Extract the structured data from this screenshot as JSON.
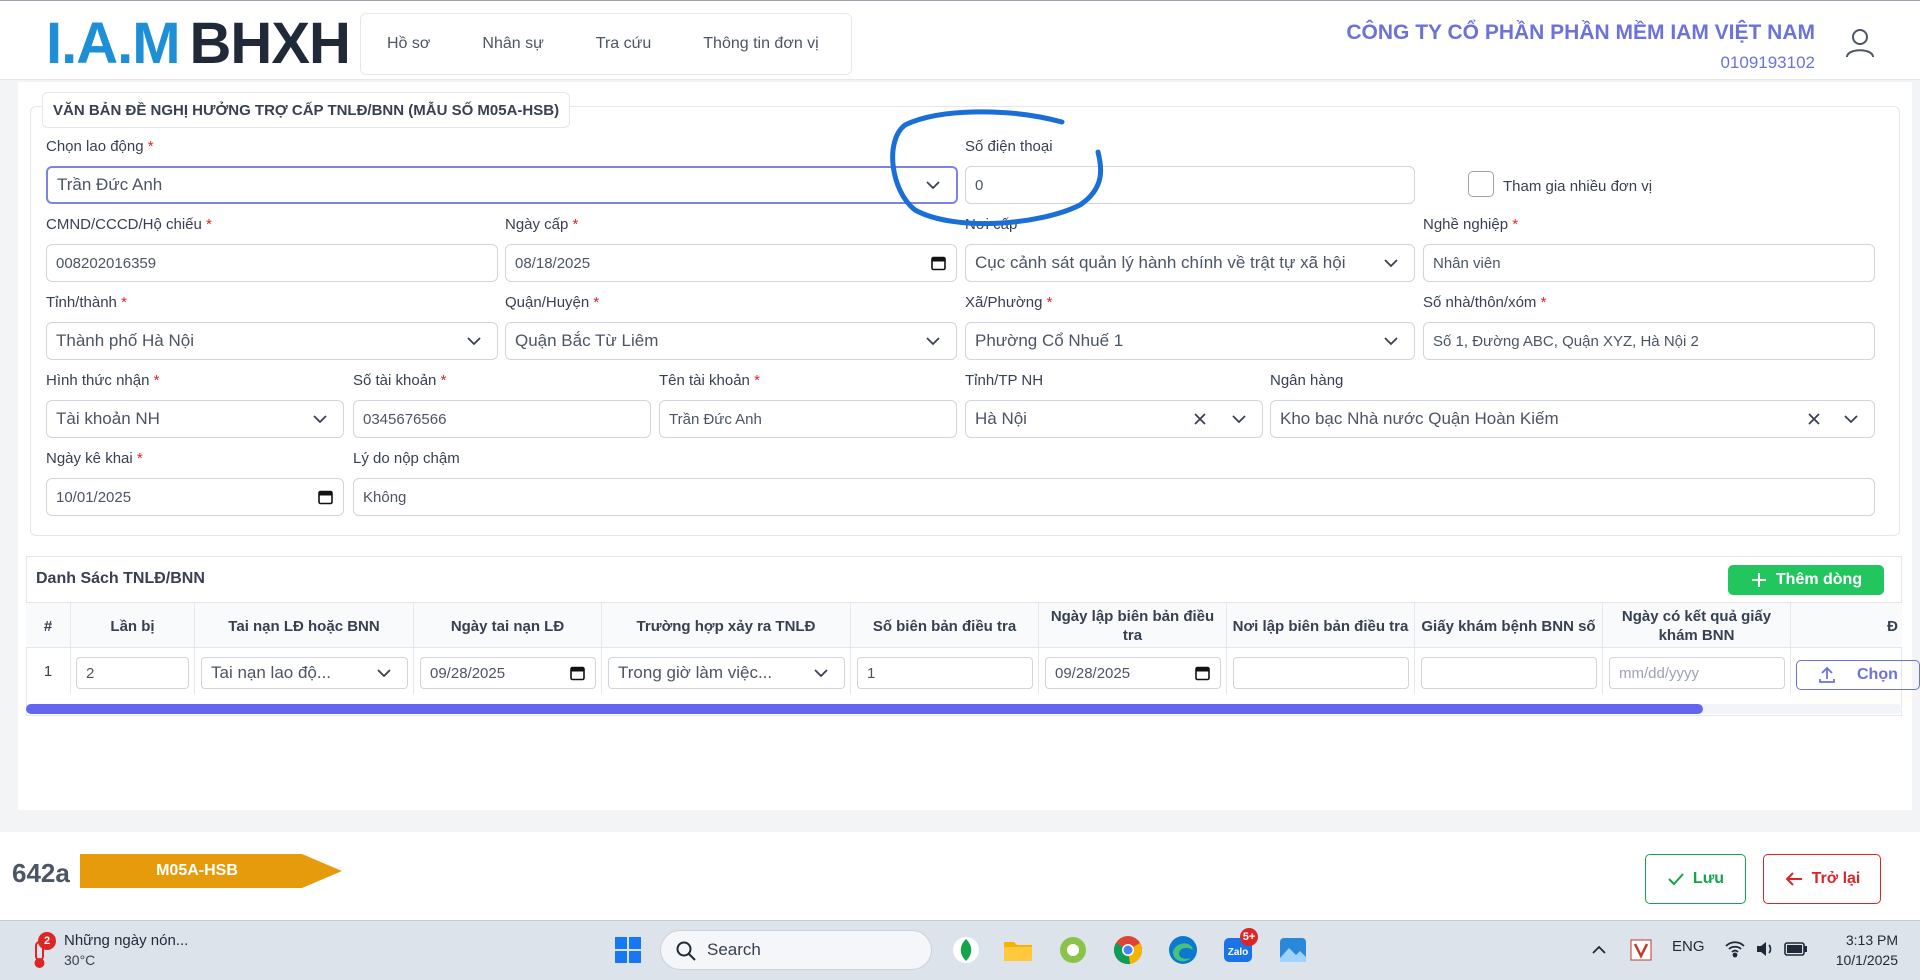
{
  "app": {
    "logo_iam": "I.A.M",
    "logo_bhxh": "BHXH"
  },
  "nav": [
    "Hồ sơ",
    "Nhân sự",
    "Tra cứu",
    "Thông tin đơn vị"
  ],
  "company": {
    "name": "CÔNG TY CỔ PHẦN PHẦN MỀM IAM VIỆT NAM",
    "tax_code": "0109193102"
  },
  "form": {
    "title": "VĂN BẢN ĐỀ NGHỊ HƯỞNG TRỢ CẤP TNLĐ/BNN (MẪU SỐ M05A-HSB)",
    "chon_lao_dong": {
      "label": "Chọn lao động",
      "value": "Trần Đức Anh"
    },
    "so_dien_thoai": {
      "label": "Số điện thoại",
      "value": "0"
    },
    "tham_gia": {
      "label": "Tham gia nhiều đơn vị"
    },
    "cmnd": {
      "label": "CMND/CCCD/Hộ chiếu",
      "value": "008202016359"
    },
    "ngay_cap": {
      "label": "Ngày cấp",
      "value": "08/18/2025"
    },
    "noi_cap": {
      "label": "Nơi cấp",
      "value": "Cục cảnh sát quản lý hành chính về trật tự xã hội"
    },
    "nghe_nghiep": {
      "label": "Nghề nghiệp",
      "value": "Nhân viên"
    },
    "tinh_thanh": {
      "label": "Tỉnh/thành",
      "value": "Thành phố Hà Nội"
    },
    "quan_huyen": {
      "label": "Quận/Huyện",
      "value": "Quận Bắc Từ Liêm"
    },
    "xa_phuong": {
      "label": "Xã/Phường",
      "value": "Phường Cổ Nhuế 1"
    },
    "so_nha": {
      "label": "Số nhà/thôn/xóm",
      "value": "Số 1, Đường ABC, Quận XYZ, Hà Nội 2"
    },
    "hinh_thuc_nhan": {
      "label": "Hình thức nhận",
      "value": "Tài khoản NH"
    },
    "so_tai_khoan": {
      "label": "Số tài khoản",
      "value": "0345676566"
    },
    "ten_tai_khoan": {
      "label": "Tên tài khoản",
      "value": "Trần Đức Anh"
    },
    "tinh_tp_nh": {
      "label": "Tỉnh/TP NH",
      "value": "Hà Nội"
    },
    "ngan_hang": {
      "label": "Ngân hàng",
      "value": "Kho bạc Nhà nước Quận Hoàn Kiếm"
    },
    "ngay_ke_khai": {
      "label": "Ngày kê khai",
      "value": "10/01/2025"
    },
    "ly_do": {
      "label": "Lý do nộp chậm",
      "value": "Không"
    }
  },
  "table": {
    "title": "Danh Sách TNLĐ/BNN",
    "add_label": "Thêm dòng",
    "headers": [
      "#",
      "Lần bị",
      "Tai nạn LĐ hoặc BNN",
      "Ngày tai nạn LĐ",
      "Trường hợp xảy ra TNLĐ",
      "Số biên bản điều tra",
      "Ngày lập biên bản điều tra",
      "Nơi lập biên bản điều tra",
      "Giấy khám bệnh BNN số",
      "Ngày có kết quả giấy khám BNN",
      "Đ"
    ],
    "rows": [
      {
        "index": "1",
        "lan_bi": "2",
        "loai": "Tai nạn lao độ...",
        "ngay_tai_nan": "09/28/2025",
        "truong_hop": "Trong giờ làm việc...",
        "so_bien_ban": "1",
        "ngay_lap": "09/28/2025",
        "noi_lap": "",
        "giay_kham": "",
        "ngay_ket_qua_placeholder": "mm/dd/yyyy",
        "upload_label": "Chọn"
      }
    ]
  },
  "footer": {
    "code": "642a",
    "form_tag": "M05A-HSB",
    "save_label": "Lưu",
    "back_label": "Trở lại"
  },
  "taskbar": {
    "weather_text": "Những ngày nón...",
    "temperature": "30°C",
    "weather_badge": "2",
    "search_placeholder": "Search",
    "zalo_badge": "5+",
    "language": "ENG",
    "time": "3:13 PM",
    "date": "10/1/2025"
  },
  "colors": {
    "accent": "#6366f1",
    "success": "#22c55e",
    "danger": "#dc2626",
    "tag": "#e69b0c",
    "annotation": "#1a6fd6"
  }
}
